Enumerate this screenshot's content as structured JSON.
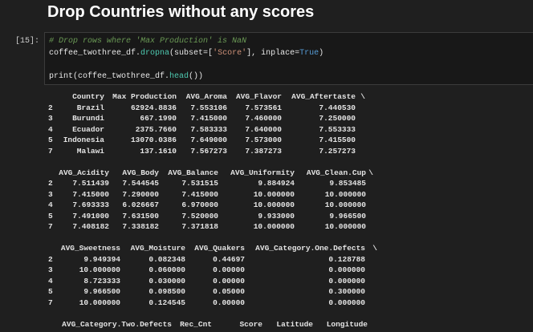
{
  "heading": "Drop Countries without any scores",
  "prompt": "[15]:",
  "code": {
    "comment": "# Drop rows where 'Max Production' is NaN",
    "line2": {
      "obj": "coffee_twothree_df.",
      "method": "dropna",
      "args_open": "(subset=[",
      "str": "'Score'",
      "args_mid": "], inplace=",
      "bool": "True",
      "args_close": ")"
    },
    "line3": {
      "pre": "print(coffee_twothree_df.",
      "method": "head",
      "post": "())"
    }
  },
  "output": {
    "index": [
      "2",
      "3",
      "4",
      "5",
      "7"
    ],
    "block1": {
      "headers": [
        "Country",
        "Max Production",
        "AVG_Aroma",
        "AVG_Flavor",
        "AVG_Aftertaste",
        "\\"
      ],
      "rows": [
        [
          "Brazil",
          "62924.8836",
          "7.553106",
          "7.573561",
          "7.440530"
        ],
        [
          "Burundi",
          "667.1990",
          "7.415000",
          "7.460000",
          "7.250000"
        ],
        [
          "Ecuador",
          "2375.7660",
          "7.583333",
          "7.640000",
          "7.553333"
        ],
        [
          "Indonesia",
          "13070.0386",
          "7.649000",
          "7.573000",
          "7.415500"
        ],
        [
          "Malawi",
          "137.1610",
          "7.567273",
          "7.387273",
          "7.257273"
        ]
      ]
    },
    "block2": {
      "headers": [
        "AVG_Acidity",
        "AVG_Body",
        "AVG_Balance",
        "AVG_Uniformity",
        "AVG_Clean.Cup",
        "\\"
      ],
      "rows": [
        [
          "7.511439",
          "7.544545",
          "7.531515",
          "9.884924",
          "9.853485"
        ],
        [
          "7.415000",
          "7.290000",
          "7.415000",
          "10.000000",
          "10.000000"
        ],
        [
          "7.693333",
          "6.026667",
          "6.970000",
          "10.000000",
          "10.000000"
        ],
        [
          "7.491000",
          "7.631500",
          "7.520000",
          "9.933000",
          "9.966500"
        ],
        [
          "7.408182",
          "7.338182",
          "7.371818",
          "10.000000",
          "10.000000"
        ]
      ]
    },
    "block3": {
      "headers": [
        "AVG_Sweetness",
        "AVG_Moisture",
        "AVG_Quakers",
        "AVG_Category.One.Defects",
        "\\"
      ],
      "rows": [
        [
          "9.949394",
          "0.082348",
          "0.44697",
          "0.128788"
        ],
        [
          "10.000000",
          "0.060000",
          "0.00000",
          "0.000000"
        ],
        [
          "8.723333",
          "0.030000",
          "0.00000",
          "0.000000"
        ],
        [
          "9.966500",
          "0.098500",
          "0.05000",
          "0.300000"
        ],
        [
          "10.000000",
          "0.124545",
          "0.00000",
          "0.000000"
        ]
      ]
    },
    "block4": {
      "headers": [
        "AVG_Category.Two.Defects",
        "Rec_Cnt",
        "Score",
        "Latitude",
        "Longitude"
      ]
    }
  }
}
